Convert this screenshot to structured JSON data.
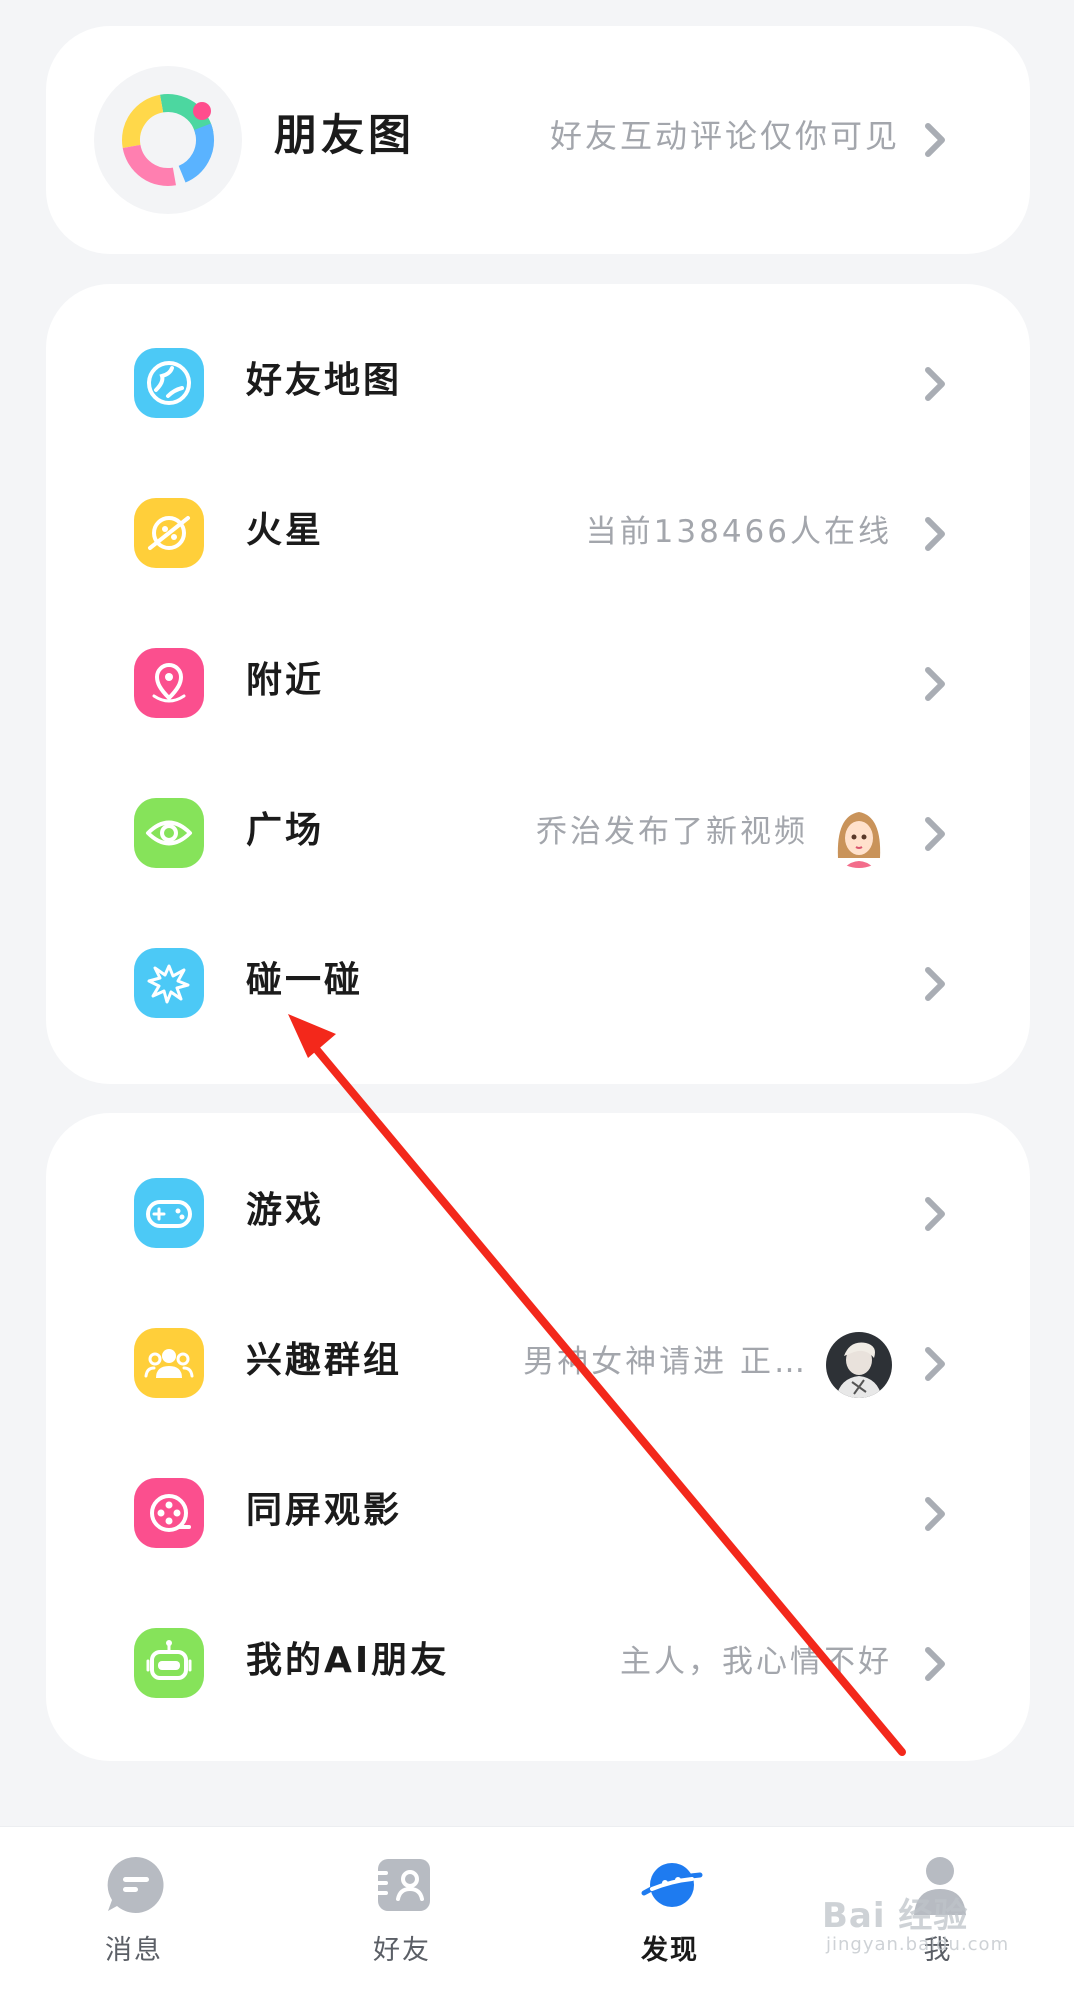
{
  "moments": {
    "title": "朋友图",
    "subtitle": "好友互动评论仅你可见"
  },
  "features": [
    {
      "label": "好友地图",
      "sub": "",
      "icon": "globe-icon",
      "color": "#4cc9f6"
    },
    {
      "label": "火星",
      "sub": "当前138466人在线",
      "icon": "planet-icon",
      "color": "#ffcf3a"
    },
    {
      "label": "附近",
      "sub": "",
      "icon": "location-pin-icon",
      "color": "#fb4f8e"
    },
    {
      "label": "广场",
      "sub": "乔治发布了新视频",
      "icon": "eye-icon",
      "color": "#86e35a"
    },
    {
      "label": "碰一碰",
      "sub": "",
      "icon": "burst-icon",
      "color": "#4cc9f6"
    }
  ],
  "extras": [
    {
      "label": "游戏",
      "sub": "",
      "icon": "gamepad-icon",
      "color": "#4cc9f6"
    },
    {
      "label": "兴趣群组",
      "sub": "男神女神请进 正…",
      "icon": "group-icon",
      "color": "#ffcf3a"
    },
    {
      "label": "同屏观影",
      "sub": "",
      "icon": "film-reel-icon",
      "color": "#fb4f8e"
    },
    {
      "label": "我的AI朋友",
      "sub": "主人，我心情不好",
      "icon": "robot-icon",
      "color": "#86e35a"
    }
  ],
  "tabbar": {
    "tabs": [
      {
        "label": "消息",
        "icon": "message-bubble-icon"
      },
      {
        "label": "好友",
        "icon": "contacts-icon"
      },
      {
        "label": "发现",
        "icon": "planet-icon",
        "active": true
      },
      {
        "label": "我",
        "icon": "profile-icon"
      }
    ]
  },
  "watermark": {
    "main": "Bai 经验",
    "sub": "jingyan.baidu.com"
  },
  "colors": {
    "accent": "#1e7bf0",
    "annotation": "#f3281b"
  }
}
